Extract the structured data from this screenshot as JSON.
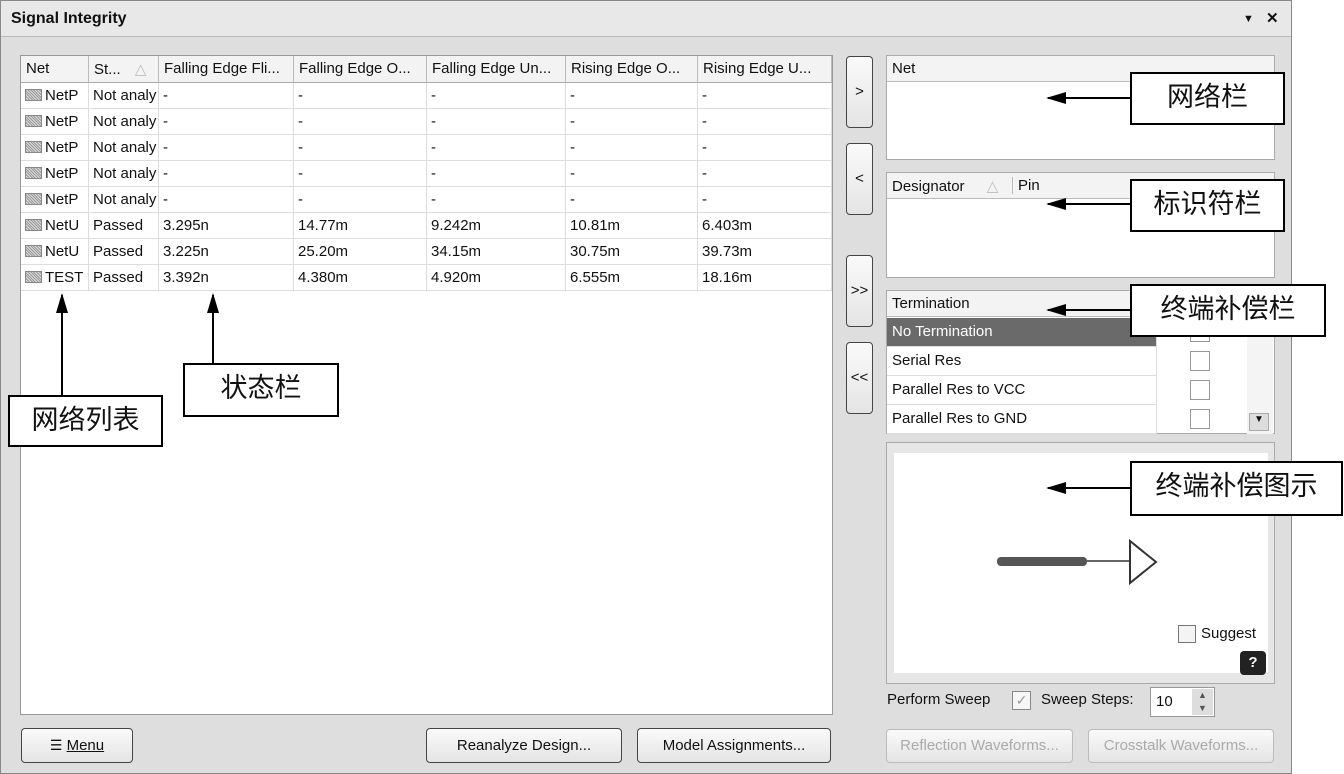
{
  "window": {
    "title": "Signal Integrity",
    "dropdown_icon": "triangle-down",
    "close_icon": "close-x"
  },
  "grid": {
    "columns": [
      "Net",
      "St...",
      "Falling Edge Fli...",
      "Falling Edge O...",
      "Falling Edge Un...",
      "Rising Edge O...",
      "Rising Edge U..."
    ],
    "rows": [
      [
        "NetP",
        "Not analy",
        "-",
        "-",
        "-",
        "-",
        "-"
      ],
      [
        "NetP",
        "Not analy",
        "-",
        "-",
        "-",
        "-",
        "-"
      ],
      [
        "NetP",
        "Not analy",
        "-",
        "-",
        "-",
        "-",
        "-"
      ],
      [
        "NetP",
        "Not analy",
        "-",
        "-",
        "-",
        "-",
        "-"
      ],
      [
        "NetP",
        "Not analy",
        "-",
        "-",
        "-",
        "-",
        "-"
      ],
      [
        "NetU",
        "Passed",
        "3.295n",
        "14.77m",
        "9.242m",
        "10.81m",
        "6.403m"
      ],
      [
        "NetU",
        "Passed",
        "3.225n",
        "25.20m",
        "34.15m",
        "30.75m",
        "39.73m"
      ],
      [
        "TEST",
        "Passed",
        "3.392n",
        "4.380m",
        "4.920m",
        "6.555m",
        "18.16m"
      ]
    ]
  },
  "transfer": {
    "move_right": ">",
    "move_left": "<",
    "move_all_right": ">>",
    "move_all_left": "<<"
  },
  "net_panel": {
    "header": "Net"
  },
  "designator_panel": {
    "col1": "Designator",
    "col2": "Pin"
  },
  "termination": {
    "header": "Termination",
    "items": [
      {
        "label": "No Termination",
        "selected": true,
        "checked": false
      },
      {
        "label": "Serial Res",
        "checked": false
      },
      {
        "label": "Parallel Res to VCC",
        "checked": false
      },
      {
        "label": "Parallel Res to GND",
        "checked": false
      }
    ]
  },
  "diagram": {
    "suggest_label": "Suggest",
    "suggest_checked": false,
    "help": "?"
  },
  "sweep": {
    "perform_label": "Perform Sweep",
    "perform_checked": true,
    "steps_label": "Sweep Steps:",
    "steps_value": "10"
  },
  "buttons": {
    "menu": "Menu",
    "reanalyze": "Reanalyze Design...",
    "model": "Model Assignments...",
    "reflection": "Reflection Waveforms...",
    "crosstalk": "Crosstalk Waveforms..."
  },
  "annotations": {
    "net_bar": "网络栏",
    "designator_bar": "标识符栏",
    "termination_bar": "终端补偿栏",
    "termination_diagram": "终端补偿图示",
    "net_list": "网络列表",
    "status_bar": "状态栏"
  }
}
